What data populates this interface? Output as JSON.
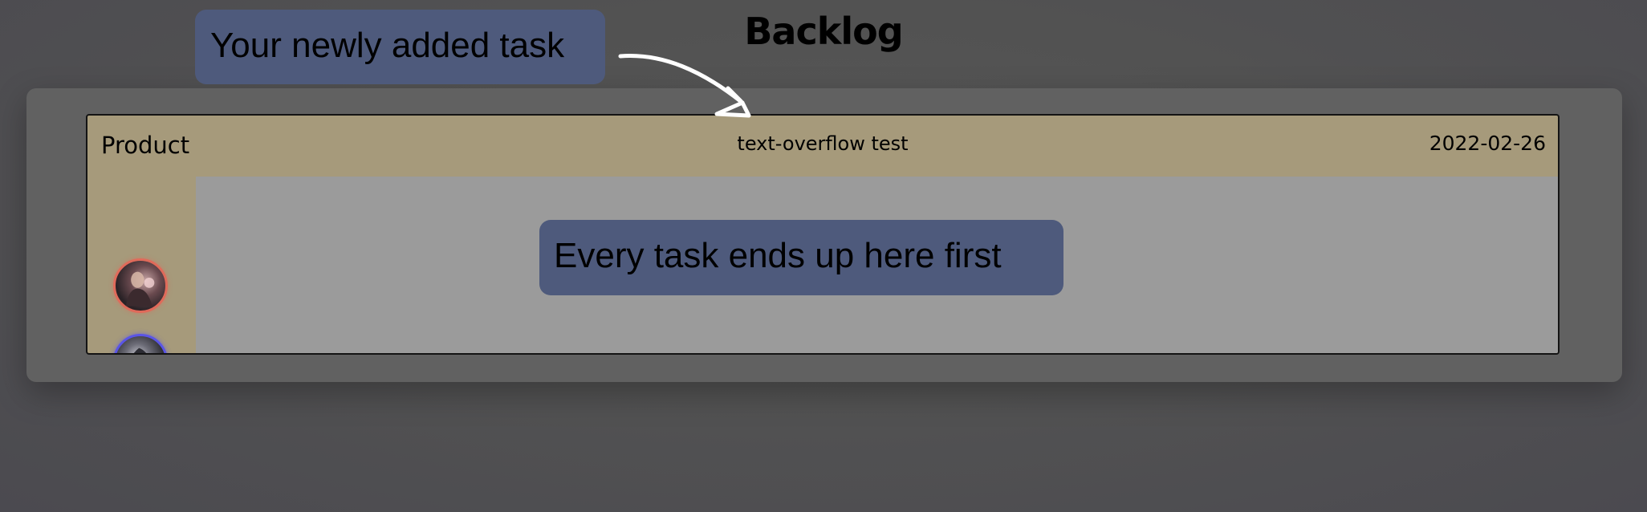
{
  "page": {
    "title": "Backlog"
  },
  "task": {
    "category": "Product",
    "title": "text-overflow test",
    "date": "2022-02-26",
    "assignees": [
      {
        "name": "avatar-1",
        "border_color": "#e06a5a"
      },
      {
        "name": "avatar-2",
        "border_color": "#5a55e6"
      }
    ]
  },
  "tooltips": {
    "new_task": "Your newly added task",
    "backlog_hint": "Every task ends up here first"
  },
  "colors": {
    "background": "#525252",
    "board": "#616161",
    "card_header": "#a69a7b",
    "card_body": "#9b9b9b",
    "tooltip": "#4e5a7c"
  }
}
